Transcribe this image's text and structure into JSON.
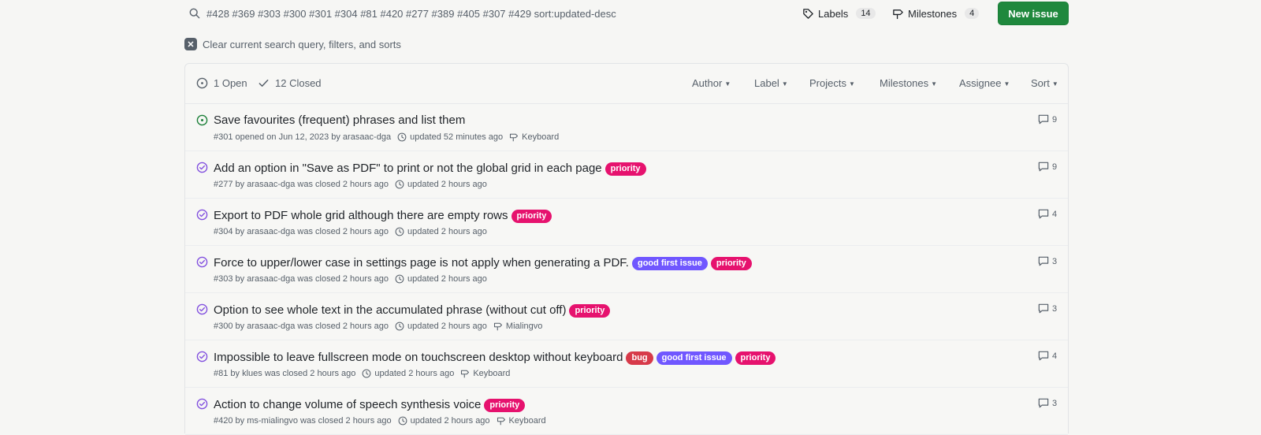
{
  "search": {
    "query": "#428 #369 #303 #300 #301 #304 #81 #420 #277 #389 #405 #307 #429 sort:updated-desc"
  },
  "toolbar": {
    "labels_label": "Labels",
    "labels_count": "14",
    "milestones_label": "Milestones",
    "milestones_count": "4",
    "new_issue_label": "New issue"
  },
  "clear_filters": "Clear current search query, filters, and sorts",
  "header": {
    "open_label": "1 Open",
    "closed_label": "12 Closed",
    "filters": [
      "Author",
      "Label",
      "Projects",
      "Milestones",
      "Assignee",
      "Sort"
    ]
  },
  "issues": [
    {
      "title": "Save favourites (frequent) phrases and list them",
      "meta": "#301 opened on Jun 12, 2023 by arasaac-dga",
      "updated": "updated 52 minutes ago",
      "milestone": "Keyboard",
      "comments": "9",
      "state": "open",
      "labels": []
    },
    {
      "title": "Add an option in \"Save as PDF\" to print or not the global grid in each page",
      "meta": "#277 by arasaac-dga was closed 2 hours ago",
      "updated": "updated 2 hours ago",
      "milestone": "",
      "comments": "9",
      "state": "closed",
      "labels": [
        "priority"
      ]
    },
    {
      "title": "Export to PDF whole grid although there are empty rows",
      "meta": "#304 by arasaac-dga was closed 2 hours ago",
      "updated": "updated 2 hours ago",
      "milestone": "",
      "comments": "4",
      "state": "closed",
      "labels": [
        "priority"
      ]
    },
    {
      "title": "Force to upper/lower case in settings page is not apply when generating a PDF.",
      "meta": "#303 by arasaac-dga was closed 2 hours ago",
      "updated": "updated 2 hours ago",
      "milestone": "",
      "comments": "3",
      "state": "closed",
      "labels": [
        "good first issue",
        "priority"
      ]
    },
    {
      "title": "Option to see whole text in the accumulated phrase (without cut off)",
      "meta": "#300 by arasaac-dga was closed 2 hours ago",
      "updated": "updated 2 hours ago",
      "milestone": "Mialingvo",
      "comments": "3",
      "state": "closed",
      "labels": [
        "priority"
      ]
    },
    {
      "title": "Impossible to leave fullscreen mode on touchscreen desktop without keyboard",
      "meta": "#81 by klues was closed 2 hours ago",
      "updated": "updated 2 hours ago",
      "milestone": "Keyboard",
      "comments": "4",
      "state": "closed",
      "labels": [
        "bug",
        "good first issue",
        "priority"
      ]
    },
    {
      "title": "Action to change volume of speech synthesis voice",
      "meta": "#420 by ms-mialingvo was closed 2 hours ago",
      "updated": "updated 2 hours ago",
      "milestone": "Keyboard",
      "comments": "3",
      "state": "closed",
      "labels": [
        "priority"
      ]
    }
  ],
  "colors": {
    "open": "#1a7f37",
    "closed": "#8250df",
    "priority": "#e6126e",
    "good_first_issue": "#7057ff",
    "bug": "#d73a4a",
    "new_issue": "#1f883d"
  }
}
